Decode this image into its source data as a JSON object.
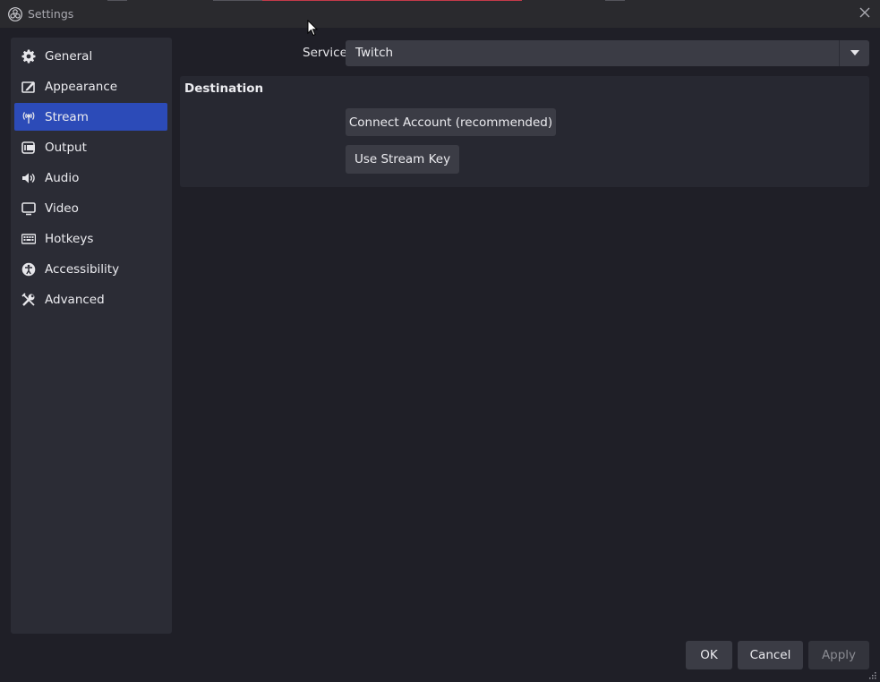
{
  "window": {
    "title": "Settings"
  },
  "sidebar": {
    "items": [
      {
        "label": "General",
        "icon": "gear-icon",
        "active": false
      },
      {
        "label": "Appearance",
        "icon": "appearance-icon",
        "active": false
      },
      {
        "label": "Stream",
        "icon": "antenna-icon",
        "active": true
      },
      {
        "label": "Output",
        "icon": "output-icon",
        "active": false
      },
      {
        "label": "Audio",
        "icon": "speaker-icon",
        "active": false
      },
      {
        "label": "Video",
        "icon": "monitor-icon",
        "active": false
      },
      {
        "label": "Hotkeys",
        "icon": "keyboard-icon",
        "active": false
      },
      {
        "label": "Accessibility",
        "icon": "accessibility-icon",
        "active": false
      },
      {
        "label": "Advanced",
        "icon": "wrench-icon",
        "active": false
      }
    ]
  },
  "stream": {
    "service_label": "Service",
    "service_value": "Twitch",
    "destination_heading": "Destination",
    "connect_account_label": "Connect Account (recommended)",
    "use_stream_key_label": "Use Stream Key"
  },
  "footer": {
    "ok_label": "OK",
    "cancel_label": "Cancel",
    "apply_label": "Apply"
  },
  "colors": {
    "accent": "#2c4bb8",
    "background": "#1f1f27",
    "panel": "#2b2c35",
    "button": "#3b3c45"
  }
}
